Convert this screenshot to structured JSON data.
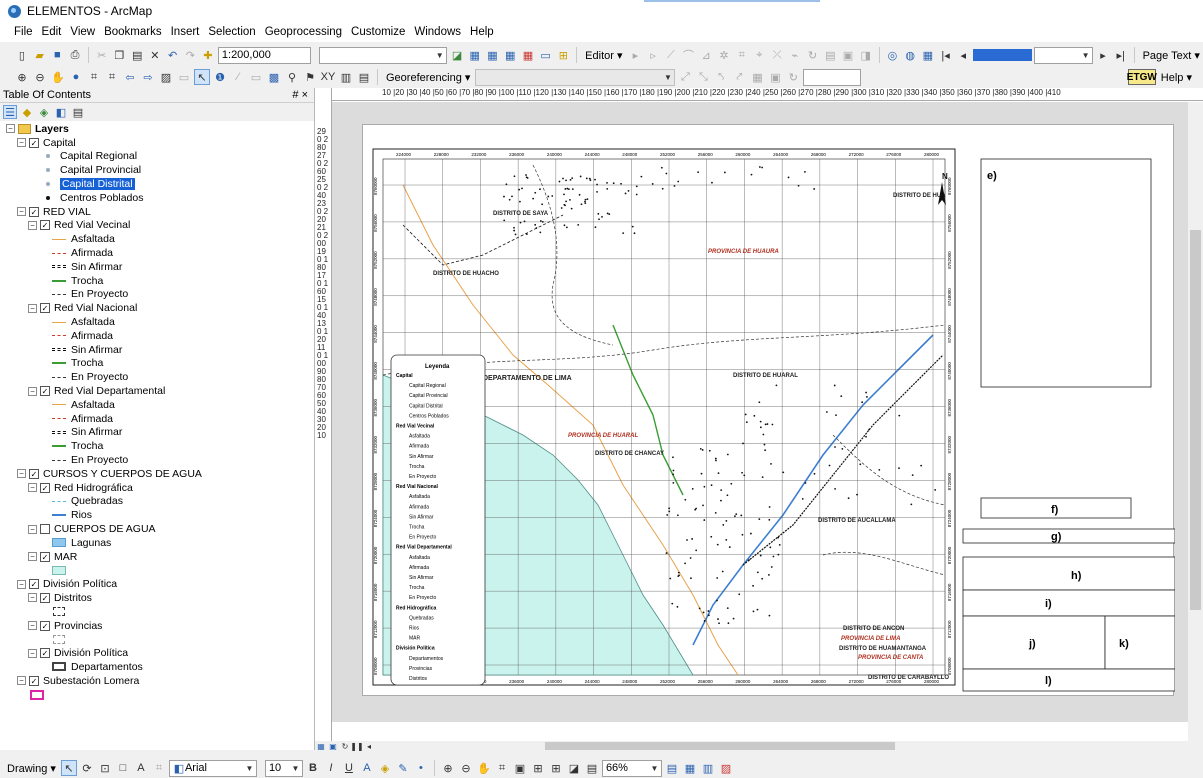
{
  "window": {
    "title": "ELEMENTOS - ArcMap"
  },
  "menu": [
    "File",
    "Edit",
    "View",
    "Bookmarks",
    "Insert",
    "Selection",
    "Geoprocessing",
    "Customize",
    "Windows",
    "Help"
  ],
  "toolbar": {
    "scale": "1:200,000",
    "editor": "Editor",
    "page_text": "Page Text",
    "georeferencing": "Georeferencing",
    "help": "Help",
    "etgw": "GW"
  },
  "toc": {
    "title": "Table Of Contents",
    "pin": "# ×",
    "rows": [
      {
        "label": "Layers",
        "indent": 0,
        "exp": "−",
        "folder": true,
        "bold": true
      },
      {
        "label": "Capital",
        "indent": 1,
        "exp": "−",
        "check": true
      },
      {
        "label": "Capital Regional",
        "indent": 3,
        "sym": "dot-sm"
      },
      {
        "label": "Capital Provincial",
        "indent": 3,
        "sym": "dot-sm"
      },
      {
        "label": "Capital Distrital",
        "indent": 3,
        "sym": "dot-sm",
        "selected": true
      },
      {
        "label": "Centros Poblados",
        "indent": 3,
        "sym": "dot-bk"
      },
      {
        "label": "RED VIAL",
        "indent": 1,
        "exp": "−",
        "check": true
      },
      {
        "label": "Red Vial Vecinal",
        "indent": 2,
        "exp": "−",
        "check": true
      },
      {
        "label": "Asfaltada",
        "indent": 4,
        "sym": "l-or"
      },
      {
        "label": "Afirmada",
        "indent": 4,
        "sym": "l-dash-red"
      },
      {
        "label": "Sin Afirmar",
        "indent": 4,
        "sym": "l-dbl"
      },
      {
        "label": "Trocha",
        "indent": 4,
        "sym": "l-grn"
      },
      {
        "label": "En Proyecto",
        "indent": 4,
        "sym": "l-dash"
      },
      {
        "label": "Red Vial Nacional",
        "indent": 2,
        "exp": "−",
        "check": true
      },
      {
        "label": "Asfaltada",
        "indent": 4,
        "sym": "l-or"
      },
      {
        "label": "Afirmada",
        "indent": 4,
        "sym": "l-dash-red"
      },
      {
        "label": "Sin Afirmar",
        "indent": 4,
        "sym": "l-dbl"
      },
      {
        "label": "Trocha",
        "indent": 4,
        "sym": "l-grn"
      },
      {
        "label": "En Proyecto",
        "indent": 4,
        "sym": "l-dash"
      },
      {
        "label": "Red Vial Departamental",
        "indent": 2,
        "exp": "−",
        "check": true
      },
      {
        "label": "Asfaltada",
        "indent": 4,
        "sym": "l-or"
      },
      {
        "label": "Afirmada",
        "indent": 4,
        "sym": "l-dash-red"
      },
      {
        "label": "Sin Afirmar",
        "indent": 4,
        "sym": "l-dbl"
      },
      {
        "label": "Trocha",
        "indent": 4,
        "sym": "l-grn"
      },
      {
        "label": "En Proyecto",
        "indent": 4,
        "sym": "l-dash"
      },
      {
        "label": "CURSOS Y CUERPOS DE AGUA",
        "indent": 1,
        "exp": "−",
        "check": true
      },
      {
        "label": "Red Hidrográfica",
        "indent": 2,
        "exp": "−",
        "check": true
      },
      {
        "label": "Quebradas",
        "indent": 4,
        "sym": "l-cyan"
      },
      {
        "label": "Rios",
        "indent": 4,
        "sym": "l-blue"
      },
      {
        "label": "CUERPOS DE AGUA",
        "indent": 2,
        "exp": "−",
        "check": false
      },
      {
        "label": "Lagunas",
        "indent": 4,
        "sym": "fill-lag"
      },
      {
        "label": "MAR",
        "indent": 2,
        "exp": "−",
        "check": true
      },
      {
        "label": "",
        "indent": 4,
        "sym": "fill-mar"
      },
      {
        "label": "División Política",
        "indent": 1,
        "exp": "−",
        "check": true
      },
      {
        "label": "Distritos",
        "indent": 2,
        "exp": "−",
        "check": true
      },
      {
        "label": "",
        "indent": 4,
        "sym": "fill-dis"
      },
      {
        "label": "Provincias",
        "indent": 2,
        "exp": "−",
        "check": true
      },
      {
        "label": "",
        "indent": 4,
        "sym": "fill-prov"
      },
      {
        "label": "División Política",
        "indent": 2,
        "exp": "−",
        "check": true
      },
      {
        "label": "Departamentos",
        "indent": 4,
        "sym": "fill-dep"
      },
      {
        "label": "Subestación Lomera",
        "indent": 1,
        "exp": "−",
        "check": true
      },
      {
        "label": "",
        "indent": 2,
        "sym": "fill-sub"
      }
    ]
  },
  "ruler": {
    "h": "10 |20 |30 |40 |50 |60 |70 |80 |90 |100 |110 |120 |130 |140 |150 |160 |170 |180 |190 |200 |210 |220 |230 |240 |250 |260 |270 |280 |290 |300 |310 |320 |330 |340 |350 |360 |370 |380 |390 |400 |410",
    "v": "290 280 270 260 250 240 230 220 210 200 190 180 170 160 150 140 130 120 110 100 90 80 70 60 50 40 30 20 10"
  },
  "map": {
    "easting": [
      "224000",
      "228000",
      "232000",
      "236000",
      "240000",
      "244000",
      "248000",
      "252000",
      "256000",
      "260000",
      "264000",
      "268000",
      "272000",
      "276000",
      "280000"
    ],
    "northing": [
      "8760000",
      "8756000",
      "8752000",
      "8748000",
      "8744000",
      "8740000",
      "8736000",
      "8732000",
      "8728000",
      "8724000",
      "8720000",
      "8716000",
      "8712000",
      "8708000"
    ],
    "labels": {
      "huacho": "DISTRITO DE HUACHO",
      "huaura": "PROVINCIA DE HUAURA",
      "dep_lima": "DEPARTAMENTO DE LIMA",
      "prov_huaral": "PROVINCIA DE HUARAL",
      "chancay": "DISTRITO DE CHANCAY",
      "d_huaral": "DISTRITO DE HUARAL",
      "aucallama": "DISTRITO DE AUCALLAMA",
      "ancon": "DISTRITO DE ANCON",
      "prov_lima": "PROVINCIA DE LIMA",
      "huamantanga": "DISTRITO DE HUAMANTANGA",
      "prov_canta": "PROVINCIA DE CANTA",
      "carabayllo": "DISTRITO DE CARABAYLLO",
      "hua": "DISTRITO DE HUA",
      "sayan": "DISTRITO DE SAYA",
      "north": "N"
    },
    "legend": {
      "title": "Leyenda",
      "items": [
        "Capital",
        "Capital Regional",
        "Capital Provincial",
        "Capital Distrital",
        "Centros Poblados",
        "Red Vial Vecinal",
        "Asfaltada",
        "Afirmada",
        "Sin Afirmar",
        "Trocha",
        "En Proyecto",
        "Red Vial Nacional",
        "Asfaltada",
        "Afirmada",
        "Sin Afirmar",
        "Trocha",
        "En Proyecto",
        "Red Vial Departamental",
        "Asfaltada",
        "Afirmada",
        "Sin Afirmar",
        "Trocha",
        "En Proyecto",
        "Red Hidrográfica",
        "Quebradas",
        "Rios",
        "MAR",
        "División Política",
        "Departamentos",
        "Provincias",
        "Distritos"
      ]
    },
    "boxes": {
      "e": "e)",
      "f": "f)",
      "g": "g)",
      "h": "h)",
      "i": "i)",
      "j": "j)",
      "k": "k)",
      "l": "l)"
    }
  },
  "drawing": {
    "label": "Drawing",
    "font": "Arial",
    "size": "10",
    "zoom": "66%"
  },
  "colors": {
    "selection": "#1661d6",
    "sea": "#cbf3ed",
    "river": "#3d7fd1",
    "road_orange": "#e9a14b",
    "trocha": "#3b9c35"
  }
}
